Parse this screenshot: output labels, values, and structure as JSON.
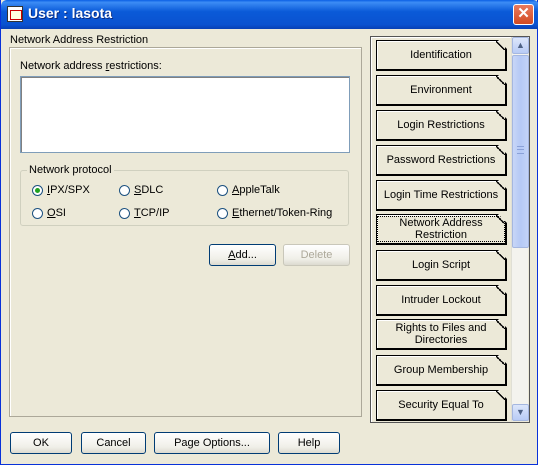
{
  "window": {
    "title": "User : lasota",
    "close_glyph": "✕"
  },
  "page": {
    "section_title": "Network Address Restriction",
    "restrictions_label_pre": "Network address ",
    "restrictions_label_u": "r",
    "restrictions_label_post": "estrictions:",
    "restrictions_value": ""
  },
  "protocol": {
    "group_label": "Network protocol",
    "options": [
      {
        "u": "I",
        "rest": "PX/SPX",
        "selected": true
      },
      {
        "u": "S",
        "rest": "DLC",
        "selected": false
      },
      {
        "u": "A",
        "rest": "ppleTalk",
        "selected": false
      },
      {
        "u": "O",
        "rest": "SI",
        "selected": false
      },
      {
        "u": "T",
        "rest": "CP/IP",
        "selected": false
      },
      {
        "u": "E",
        "rest": "thernet/Token-Ring",
        "selected": false
      }
    ]
  },
  "actions": {
    "add_u": "A",
    "add_rest": "dd...",
    "delete": "Delete"
  },
  "tabs": [
    {
      "label": "Identification"
    },
    {
      "label": "Environment"
    },
    {
      "label": "Login Restrictions"
    },
    {
      "label": "Password Restrictions"
    },
    {
      "label": "Login Time Restrictions"
    },
    {
      "label": "Network Address Restriction"
    },
    {
      "label": "Login Script"
    },
    {
      "label": "Intruder Lockout"
    },
    {
      "label": "Rights to Files and Directories"
    },
    {
      "label": "Group Membership"
    },
    {
      "label": "Security Equal To"
    }
  ],
  "scrollbar": {
    "up_glyph": "▲",
    "down_glyph": "▼"
  },
  "footer": {
    "ok": "OK",
    "cancel": "Cancel",
    "page_options": "Page Options...",
    "help": "Help"
  }
}
